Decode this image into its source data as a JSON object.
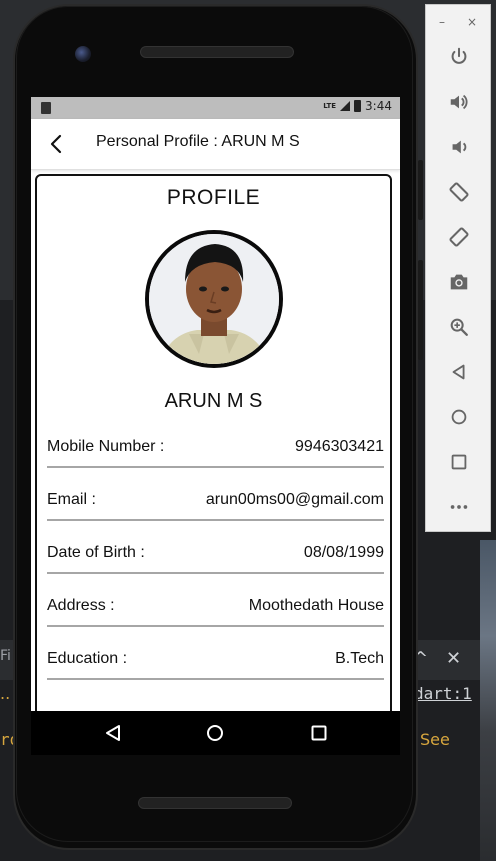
{
  "ide": {
    "tab_fragment": "Fi",
    "dots": "..",
    "console_fragment": "ro",
    "file_ref": "dart:1",
    "see_link": "See",
    "chevron": "^",
    "close": "✕"
  },
  "emulator_panel": {
    "minimize": "–",
    "close": "×",
    "buttons": [
      "power-icon",
      "volume-up-icon",
      "volume-down-icon",
      "rotate-left-icon",
      "rotate-right-icon",
      "camera-icon",
      "zoom-icon",
      "back-icon",
      "home-icon",
      "overview-icon",
      "more-icon"
    ]
  },
  "status_bar": {
    "network": "LTE",
    "time": "3:44"
  },
  "app_bar": {
    "title": "Personal Profile : ARUN M S"
  },
  "profile": {
    "heading": "PROFILE",
    "name": "ARUN M S",
    "fields": [
      {
        "label": "Mobile Number :",
        "value": "9946303421"
      },
      {
        "label": "Email :",
        "value": "arun00ms00@gmail.com"
      },
      {
        "label": "Date of Birth :",
        "value": "08/08/1999"
      },
      {
        "label": "Address :",
        "value": "Moothedath House"
      },
      {
        "label": "Education :",
        "value": "B.Tech"
      }
    ]
  },
  "colors": {
    "status_bar": "#bdbdbd",
    "card_border": "#111111",
    "divider": "#a6a6a6",
    "phone_body": "#0b0b0b"
  }
}
